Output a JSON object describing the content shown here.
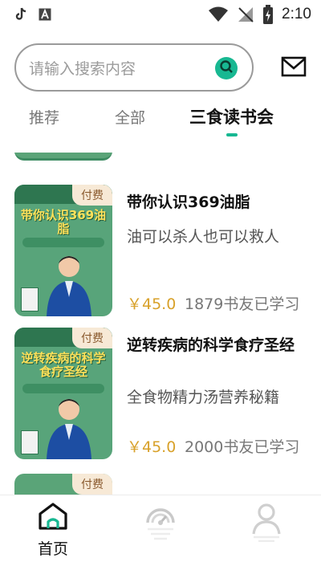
{
  "status_bar": {
    "time": "2:10"
  },
  "search": {
    "placeholder": "请输入搜索内容"
  },
  "tabs": [
    {
      "label": "推荐",
      "active": false
    },
    {
      "label": "全部",
      "active": false
    },
    {
      "label": "三食读书会",
      "active": true
    }
  ],
  "colors": {
    "accent": "#18b892",
    "price": "#d8a12a",
    "cover_green": "#58a47a"
  },
  "courses": [
    {
      "badge": "付费",
      "cover_title": "带你认识369油脂",
      "title": "带你认识369油脂",
      "subtitle": "油可以杀人也可以救人",
      "price": "￥45.0",
      "learners": "1879书友已学习"
    },
    {
      "badge": "付费",
      "cover_title": "逆转疾病的科学食疗圣经",
      "title": "逆转疾病的科学食疗圣经",
      "subtitle": "全食物精力汤营养秘籍",
      "price": "￥45.0",
      "learners": "2000书友已学习"
    }
  ],
  "next_badge": "付费",
  "bottom_nav": [
    {
      "label": "首页",
      "icon": "home-icon",
      "active": true
    },
    {
      "label": "",
      "icon": "gauge-icon",
      "active": false
    },
    {
      "label": "",
      "icon": "user-icon",
      "active": false
    }
  ]
}
